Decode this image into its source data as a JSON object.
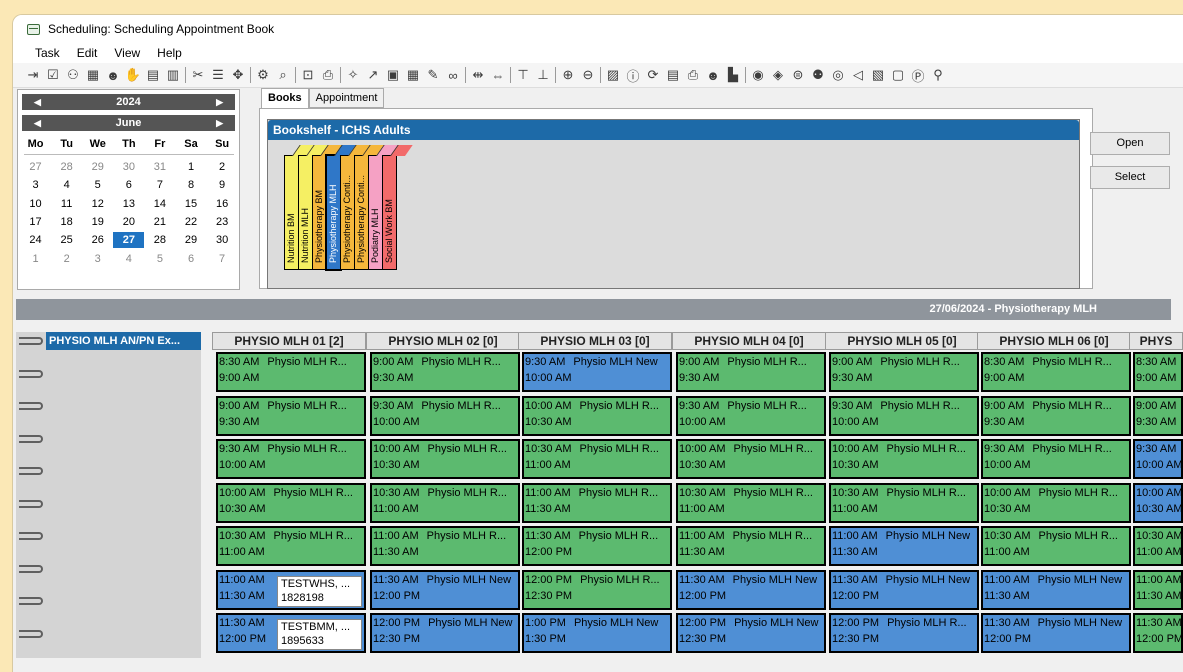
{
  "window": {
    "title": "Scheduling: Scheduling Appointment Book"
  },
  "menu": [
    "Task",
    "Edit",
    "View",
    "Help"
  ],
  "toolbar_icons": [
    "exit-icon",
    "check-icon",
    "users-icon",
    "calendar-icon",
    "person-icon",
    "hand-icon",
    "notes-icon",
    "book-icon",
    "sep",
    "scissors-icon",
    "list-icon",
    "move-icon",
    "sep",
    "gear-icon",
    "search-icon",
    "sep",
    "lock-icon",
    "print-icon",
    "sep",
    "compass-icon",
    "arrow-icon",
    "clipboard-icon",
    "grid-icon",
    "pen-icon",
    "link-icon",
    "sep",
    "fit-width-icon",
    "expand-icon",
    "sep",
    "align-top-icon",
    "align-bottom-icon",
    "sep",
    "zoom-in-icon",
    "zoom-out-icon",
    "sep",
    "image-icon",
    "info-icon",
    "refresh-icon",
    "report-icon",
    "print-icon",
    "person-icon",
    "chart-icon",
    "sep",
    "palette-icon",
    "shield-icon",
    "globe-icon",
    "people-icon",
    "eye-icon",
    "back-icon",
    "document-icon",
    "window-icon",
    "p-icon",
    "user-icon"
  ],
  "calendar": {
    "year": "2024",
    "month": "June",
    "weekdays": [
      "Mo",
      "Tu",
      "We",
      "Th",
      "Fr",
      "Sa",
      "Su"
    ],
    "weeks": [
      [
        [
          "27",
          true
        ],
        [
          "28",
          true
        ],
        [
          "29",
          true
        ],
        [
          "30",
          true
        ],
        [
          "31",
          true
        ],
        [
          "1",
          false
        ],
        [
          "2",
          false
        ]
      ],
      [
        [
          "3",
          false
        ],
        [
          "4",
          false
        ],
        [
          "5",
          false
        ],
        [
          "6",
          false
        ],
        [
          "7",
          false
        ],
        [
          "8",
          false
        ],
        [
          "9",
          false
        ]
      ],
      [
        [
          "10",
          false
        ],
        [
          "11",
          false
        ],
        [
          "12",
          false
        ],
        [
          "13",
          false
        ],
        [
          "14",
          false
        ],
        [
          "15",
          false
        ],
        [
          "16",
          false
        ]
      ],
      [
        [
          "17",
          false
        ],
        [
          "18",
          false
        ],
        [
          "19",
          false
        ],
        [
          "20",
          false
        ],
        [
          "21",
          false
        ],
        [
          "22",
          false
        ],
        [
          "23",
          false
        ]
      ],
      [
        [
          "24",
          false
        ],
        [
          "25",
          false
        ],
        [
          "26",
          false
        ],
        [
          "27",
          false
        ],
        [
          "28",
          false
        ],
        [
          "29",
          false
        ],
        [
          "30",
          false
        ]
      ],
      [
        [
          "1",
          true
        ],
        [
          "2",
          true
        ],
        [
          "3",
          true
        ],
        [
          "4",
          true
        ],
        [
          "5",
          true
        ],
        [
          "6",
          true
        ],
        [
          "7",
          true
        ]
      ]
    ],
    "selected": "27"
  },
  "tabs": [
    "Books",
    "Appointment"
  ],
  "bookshelf": {
    "title": "Bookshelf - ICHS Adults",
    "books": [
      {
        "label": "Nutrition BM",
        "color": "#f5ef63",
        "selected": false
      },
      {
        "label": "Nutrition MLH",
        "color": "#f5ef63",
        "selected": false
      },
      {
        "label": "Physiotherapy BM",
        "color": "#f5b73c",
        "selected": false
      },
      {
        "label": "Physiotherapy MLH",
        "color": "#2f77c8",
        "selected": true
      },
      {
        "label": "Physiotherapy Conti...",
        "color": "#f5b73c",
        "selected": false
      },
      {
        "label": "Physiotherapy Conti...",
        "color": "#f5b73c",
        "selected": false
      },
      {
        "label": "Podiatry MLH",
        "color": "#f5a1c4",
        "selected": false
      },
      {
        "label": "Social Work BM",
        "color": "#f26a6a",
        "selected": false
      }
    ]
  },
  "buttons": {
    "open": "Open",
    "select": "Select"
  },
  "schedule": {
    "date_title": "27/06/2024 - Physiotherapy MLH",
    "first_col": "PHYSIO MLH AN/PN Ex...",
    "columns": [
      {
        "header": "PHYSIO MLH 01 [2]",
        "slots": [
          {
            "start": "8:30 AM",
            "label": "Physio MLH R...",
            "end": "9:00 AM",
            "color": "g"
          },
          {
            "start": "9:00 AM",
            "label": "Physio MLH R...",
            "end": "9:30 AM",
            "color": "g"
          },
          {
            "start": "9:30 AM",
            "label": "Physio MLH R...",
            "end": "10:00 AM",
            "color": "g"
          },
          {
            "start": "10:00 AM",
            "label": "Physio MLH R...",
            "end": "10:30 AM",
            "color": "g"
          },
          {
            "start": "10:30 AM",
            "label": "Physio MLH R...",
            "end": "11:00 AM",
            "color": "g"
          },
          {
            "start": "11:00 AM",
            "label": "",
            "end": "11:30 AM",
            "color": "b",
            "patient": [
              "TESTWHS, ...",
              "1828198"
            ]
          },
          {
            "start": "11:30 AM",
            "label": "",
            "end": "12:00 PM",
            "color": "b",
            "patient": [
              "TESTBMM, ...",
              "1895633"
            ]
          }
        ]
      },
      {
        "header": "PHYSIO MLH 02 [0]",
        "slots": [
          {
            "start": "9:00 AM",
            "label": "Physio MLH R...",
            "end": "9:30 AM",
            "color": "g"
          },
          {
            "start": "9:30 AM",
            "label": "Physio MLH R...",
            "end": "10:00 AM",
            "color": "g"
          },
          {
            "start": "10:00 AM",
            "label": "Physio MLH R...",
            "end": "10:30 AM",
            "color": "g"
          },
          {
            "start": "10:30 AM",
            "label": "Physio MLH R...",
            "end": "11:00 AM",
            "color": "g"
          },
          {
            "start": "11:00 AM",
            "label": "Physio MLH R...",
            "end": "11:30 AM",
            "color": "g"
          },
          {
            "start": "11:30 AM",
            "label": "Physio MLH New",
            "end": "12:00 PM",
            "color": "b"
          },
          {
            "start": "12:00 PM",
            "label": "Physio MLH New",
            "end": "12:30 PM",
            "color": "b"
          }
        ]
      },
      {
        "header": "PHYSIO MLH 03 [0]",
        "slots": [
          {
            "start": "9:30 AM",
            "label": "Physio MLH New",
            "end": "10:00 AM",
            "color": "b"
          },
          {
            "start": "10:00 AM",
            "label": "Physio MLH R...",
            "end": "10:30 AM",
            "color": "g"
          },
          {
            "start": "10:30 AM",
            "label": "Physio MLH R...",
            "end": "11:00 AM",
            "color": "g"
          },
          {
            "start": "11:00 AM",
            "label": "Physio MLH R...",
            "end": "11:30 AM",
            "color": "g"
          },
          {
            "start": "11:30 AM",
            "label": "Physio MLH R...",
            "end": "12:00 PM",
            "color": "g"
          },
          {
            "start": "12:00 PM",
            "label": "Physio MLH R...",
            "end": "12:30 PM",
            "color": "g"
          },
          {
            "start": "1:00 PM",
            "label": "Physio MLH New",
            "end": "1:30 PM",
            "color": "b"
          }
        ]
      },
      {
        "header": "PHYSIO MLH 04 [0]",
        "slots": [
          {
            "start": "9:00 AM",
            "label": "Physio MLH R...",
            "end": "9:30 AM",
            "color": "g"
          },
          {
            "start": "9:30 AM",
            "label": "Physio MLH R...",
            "end": "10:00 AM",
            "color": "g"
          },
          {
            "start": "10:00 AM",
            "label": "Physio MLH R...",
            "end": "10:30 AM",
            "color": "g"
          },
          {
            "start": "10:30 AM",
            "label": "Physio MLH R...",
            "end": "11:00 AM",
            "color": "g"
          },
          {
            "start": "11:00 AM",
            "label": "Physio MLH R...",
            "end": "11:30 AM",
            "color": "g"
          },
          {
            "start": "11:30 AM",
            "label": "Physio MLH New",
            "end": "12:00 PM",
            "color": "b"
          },
          {
            "start": "12:00 PM",
            "label": "Physio MLH New",
            "end": "12:30 PM",
            "color": "b"
          }
        ]
      },
      {
        "header": "PHYSIO MLH 05 [0]",
        "slots": [
          {
            "start": "9:00 AM",
            "label": "Physio MLH R...",
            "end": "9:30 AM",
            "color": "g"
          },
          {
            "start": "9:30 AM",
            "label": "Physio MLH R...",
            "end": "10:00 AM",
            "color": "g"
          },
          {
            "start": "10:00 AM",
            "label": "Physio MLH R...",
            "end": "10:30 AM",
            "color": "g"
          },
          {
            "start": "10:30 AM",
            "label": "Physio MLH R...",
            "end": "11:00 AM",
            "color": "g"
          },
          {
            "start": "11:00 AM",
            "label": "Physio MLH New",
            "end": "11:30 AM",
            "color": "b"
          },
          {
            "start": "11:30 AM",
            "label": "Physio MLH New",
            "end": "12:00 PM",
            "color": "b"
          },
          {
            "start": "12:00 PM",
            "label": "Physio MLH R...",
            "end": "12:30 PM",
            "color": "b"
          }
        ]
      },
      {
        "header": "PHYSIO MLH 06 [0]",
        "slots": [
          {
            "start": "8:30 AM",
            "label": "Physio MLH R...",
            "end": "9:00 AM",
            "color": "g"
          },
          {
            "start": "9:00 AM",
            "label": "Physio MLH R...",
            "end": "9:30 AM",
            "color": "g"
          },
          {
            "start": "9:30 AM",
            "label": "Physio MLH R...",
            "end": "10:00 AM",
            "color": "g"
          },
          {
            "start": "10:00 AM",
            "label": "Physio MLH R...",
            "end": "10:30 AM",
            "color": "g"
          },
          {
            "start": "10:30 AM",
            "label": "Physio MLH R...",
            "end": "11:00 AM",
            "color": "g"
          },
          {
            "start": "11:00 AM",
            "label": "Physio MLH New",
            "end": "11:30 AM",
            "color": "b"
          },
          {
            "start": "11:30 AM",
            "label": "Physio MLH New",
            "end": "12:00 PM",
            "color": "b"
          }
        ]
      },
      {
        "header": "PHYS",
        "slots": [
          {
            "start": "8:30 AM",
            "label": "",
            "end": "9:00 AM",
            "color": "g"
          },
          {
            "start": "9:00 AM",
            "label": "",
            "end": "9:30 AM",
            "color": "g"
          },
          {
            "start": "9:30 AM",
            "label": "",
            "end": "10:00 AM",
            "color": "b"
          },
          {
            "start": "10:00 AM",
            "label": "",
            "end": "10:30 AM",
            "color": "b"
          },
          {
            "start": "10:30 AM",
            "label": "",
            "end": "11:00 AM",
            "color": "g"
          },
          {
            "start": "11:00 AM",
            "label": "",
            "end": "11:30 AM",
            "color": "g"
          },
          {
            "start": "11:30 AM",
            "label": "",
            "end": "12:00 PM",
            "color": "g"
          }
        ]
      }
    ]
  },
  "colors": {
    "green": "#5cba6f",
    "blue": "#4f8fd5",
    "accent": "#1d6aa8"
  }
}
